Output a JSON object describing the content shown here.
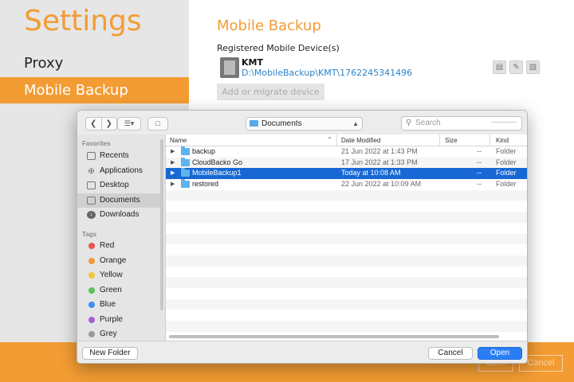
{
  "app": {
    "title": "Settings",
    "sidebar_items": [
      {
        "label": "Proxy"
      },
      {
        "label": "Mobile Backup"
      }
    ],
    "section_title": "Mobile Backup",
    "registered_label": "Registered Mobile Device(s)",
    "device": {
      "name": "KMT",
      "path": "D:\\MobileBackup\\KMT\\1762245341496"
    },
    "add_device_label": "Add or migrate device",
    "footer": {
      "save_label": "Save",
      "cancel_label": "Cancel"
    },
    "colors": {
      "accent": "#f39c33",
      "link": "#2b82c9"
    }
  },
  "dialog": {
    "location": "Documents",
    "search_placeholder": "Search",
    "sidebar": {
      "favorites_heading": "Favorites",
      "favorites": [
        {
          "label": "Recents",
          "icon": "clock-icon"
        },
        {
          "label": "Applications",
          "icon": "applications-icon"
        },
        {
          "label": "Desktop",
          "icon": "desktop-icon"
        },
        {
          "label": "Documents",
          "icon": "document-icon"
        },
        {
          "label": "Downloads",
          "icon": "download-icon"
        }
      ],
      "tags_heading": "Tags",
      "tags": [
        {
          "label": "Red",
          "color": "#e8544b"
        },
        {
          "label": "Orange",
          "color": "#f19a37"
        },
        {
          "label": "Yellow",
          "color": "#f4c73a"
        },
        {
          "label": "Green",
          "color": "#5ac25b"
        },
        {
          "label": "Blue",
          "color": "#3d8ff0"
        },
        {
          "label": "Purple",
          "color": "#a35fd0"
        },
        {
          "label": "Grey",
          "color": "#9b9b9b"
        }
      ]
    },
    "columns": {
      "name": "Name",
      "date": "Date Modified",
      "size": "Size",
      "kind": "Kind"
    },
    "files": [
      {
        "name": "backup",
        "date": "21 Jun 2022 at 1:43 PM",
        "size": "--",
        "kind": "Folder"
      },
      {
        "name": "CloudBacko Go",
        "date": "17 Jun 2022 at 1:33 PM",
        "size": "--",
        "kind": "Folder"
      },
      {
        "name": "MobileBackup1",
        "date": "Today at 10:08 AM",
        "size": "--",
        "kind": "Folder"
      },
      {
        "name": "restored",
        "date": "22 Jun 2022 at 10:09 AM",
        "size": "--",
        "kind": "Folder"
      }
    ],
    "buttons": {
      "new_folder": "New Folder",
      "cancel": "Cancel",
      "open": "Open"
    }
  }
}
